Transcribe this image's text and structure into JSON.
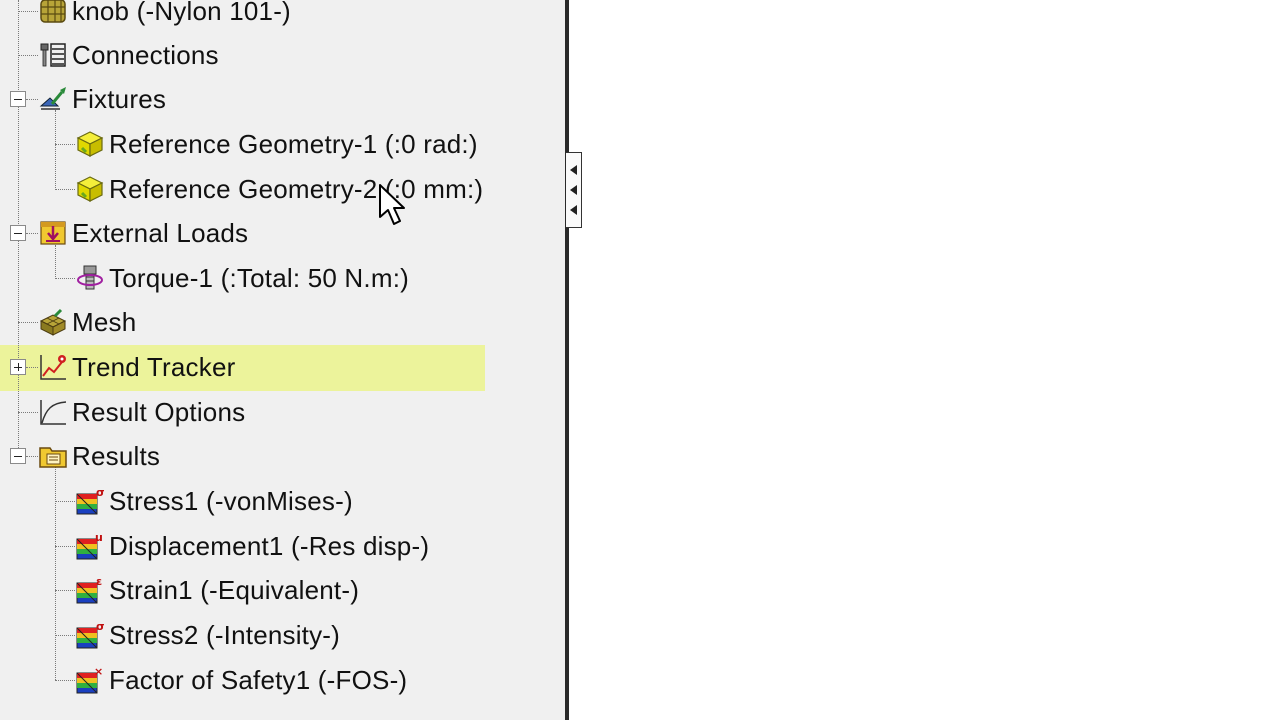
{
  "tree": {
    "items": [
      {
        "label": "knob (-Nylon 101-)",
        "icon": "material-grid-icon"
      },
      {
        "label": "Connections",
        "icon": "connections-icon"
      },
      {
        "label": "Fixtures",
        "icon": "fixtures-icon",
        "expanded": true
      },
      {
        "label": "Reference Geometry-1 (:0 rad:)",
        "icon": "reference-geometry-icon"
      },
      {
        "label": "Reference Geometry-2 (:0 mm:)",
        "icon": "reference-geometry-icon"
      },
      {
        "label": "External Loads",
        "icon": "external-loads-icon",
        "expanded": true
      },
      {
        "label": "Torque-1 (:Total: 50 N.m:)",
        "icon": "torque-icon"
      },
      {
        "label": "Mesh",
        "icon": "mesh-icon"
      },
      {
        "label": "Trend Tracker",
        "icon": "trend-tracker-icon",
        "expanded": false,
        "selected": true
      },
      {
        "label": "Result Options",
        "icon": "result-options-icon"
      },
      {
        "label": "Results",
        "icon": "results-folder-icon",
        "expanded": true
      },
      {
        "label": "Stress1 (-vonMises-)",
        "icon": "stress-plot-icon",
        "badge": "σ"
      },
      {
        "label": "Displacement1 (-Res disp-)",
        "icon": "displacement-plot-icon",
        "badge": "u"
      },
      {
        "label": "Strain1 (-Equivalent-)",
        "icon": "strain-plot-icon",
        "badge": "ε"
      },
      {
        "label": "Stress2 (-Intensity-)",
        "icon": "stress-plot-icon",
        "badge": "σ"
      },
      {
        "label": "Factor of Safety1 (-FOS-)",
        "icon": "factor-of-safety-plot-icon",
        "badge": "×"
      }
    ]
  },
  "colors": {
    "panel_bg": "#f0f0f0",
    "selection_highlight": "#ecf39b",
    "geometry_yellow": "#e8e000",
    "geometry_green": "#6aa81e"
  }
}
